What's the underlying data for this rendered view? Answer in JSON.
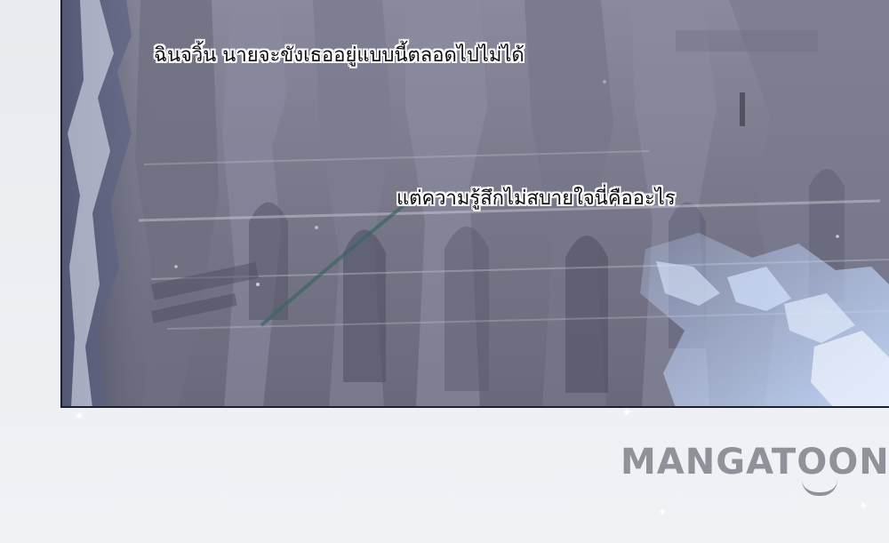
{
  "panel": {
    "caption_top": "ฉินจวิ้น นายจะขังเธออยู่แบบนี้ตลอดไปไม่ได้",
    "caption_middle": "แต่ความรู้สึกไม่สบายใจนี่คืออะไร"
  },
  "footer": {
    "logo_text": "MANGATOON"
  },
  "colors": {
    "background": "#eceef3",
    "panel_stone": "#7f7f91",
    "panel_border": "#1f1f29",
    "logo": "#8f9298",
    "caption_text": "#0d0d12",
    "caption_outline": "#ffffff"
  },
  "icons": {
    "sparkle": "sparkle-icon"
  }
}
